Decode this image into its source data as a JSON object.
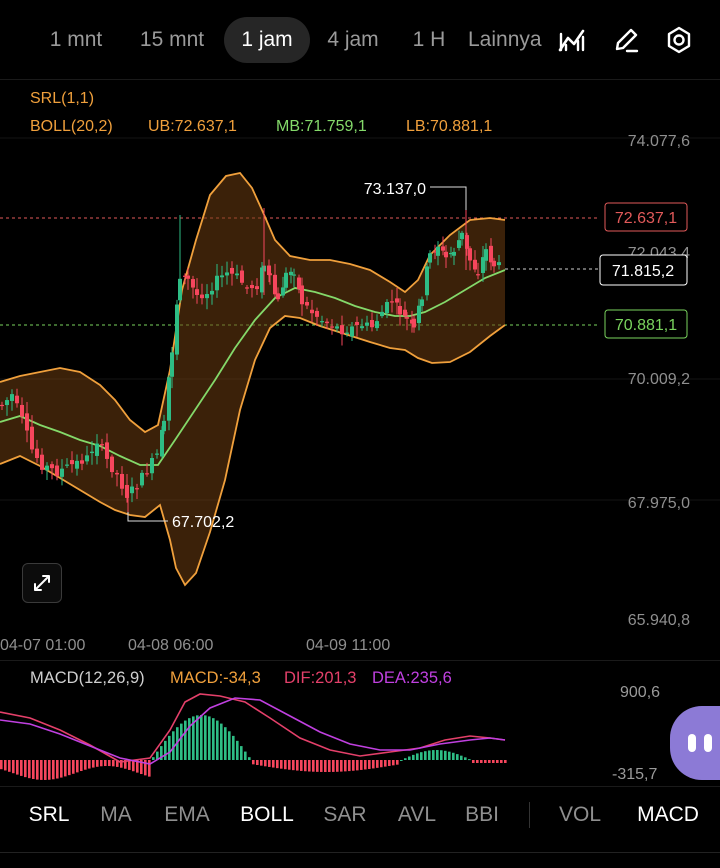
{
  "timeframe_tabs": [
    {
      "label": "1 mnt",
      "active": false
    },
    {
      "label": "15 mnt",
      "active": false
    },
    {
      "label": "1 jam",
      "active": true
    },
    {
      "label": "4 jam",
      "active": false
    },
    {
      "label": "1 H",
      "active": false
    },
    {
      "label": "Lainnya",
      "active": false
    }
  ],
  "toolbar_icons": [
    "chart-type-icon",
    "draw-pen-icon",
    "settings-gear-icon"
  ],
  "legend": {
    "srl": "SRL(1,1)",
    "boll": "BOLL(20,2)",
    "ub": "UB:72.637,1",
    "mb": "MB:71.759,1",
    "lb": "LB:70.881,1"
  },
  "colors": {
    "up": "#2ebd85",
    "down": "#f6465d",
    "band": "#f0a03c",
    "mid": "#84d96a",
    "macd_line": "#e4406a",
    "dea_line": "#c040e0"
  },
  "chart_data": {
    "type": "candlestick",
    "y_ticks": [
      "74.077,6",
      "72.043,4",
      "70.009,2",
      "67.975,0",
      "65.940,8"
    ],
    "x_ticks": [
      "04-07 01:00",
      "04-08 06:00",
      "04-09 11:00"
    ],
    "annotations": {
      "high": "73.137,0",
      "low": "67.702,2",
      "ub_tag": "72.637,1",
      "current_tag": "71.815,2",
      "lb_tag": "70.881,1"
    }
  },
  "macd": {
    "title": "MACD(12,26,9)",
    "macd": "MACD:-34,3",
    "dif": "DIF:201,3",
    "dea": "DEA:235,6",
    "y_max": "900,6",
    "y_min": "-315,7"
  },
  "indicators": [
    {
      "label": "SRL",
      "on": true
    },
    {
      "label": "MA",
      "on": false
    },
    {
      "label": "EMA",
      "on": false
    },
    {
      "label": "BOLL",
      "on": true
    },
    {
      "label": "SAR",
      "on": false
    },
    {
      "label": "AVL",
      "on": false
    },
    {
      "label": "BBI",
      "on": false
    },
    {
      "label": "VOL",
      "on": false
    },
    {
      "label": "MACD",
      "on": true
    }
  ]
}
